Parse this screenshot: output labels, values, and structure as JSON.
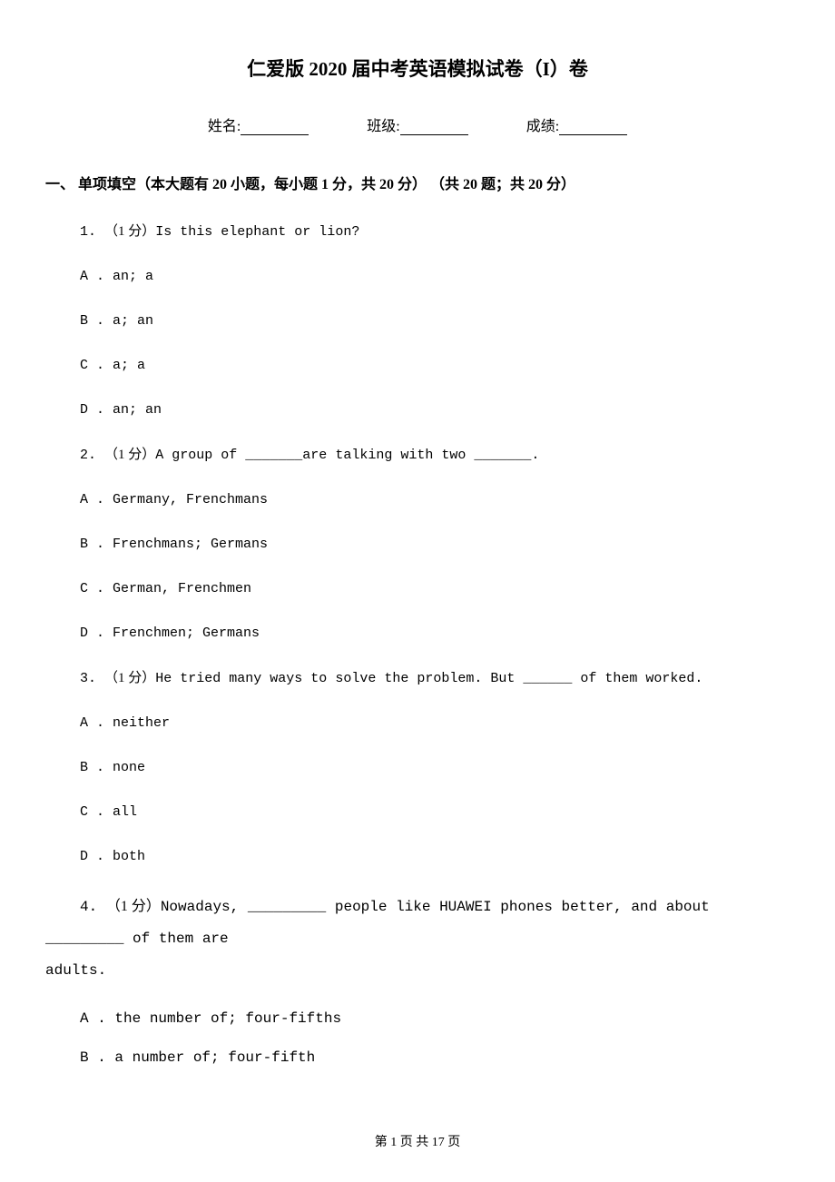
{
  "title": "仁爱版 2020 届中考英语模拟试卷（I）卷",
  "info": {
    "name_label": "姓名:",
    "class_label": "班级:",
    "score_label": "成绩:"
  },
  "section1": {
    "header": "一、 单项填空（本大题有 20 小题，每小题 1 分，共 20 分） （共 20 题；共 20 分）"
  },
  "q1": {
    "num": "1. ",
    "points": "（1 分）",
    "text_a": "Is this      elephant or        lion?",
    "options": {
      "a": "A . an; a",
      "b": "B . a; an",
      "c": "C . a; a",
      "d": "D . an; an"
    }
  },
  "q2": {
    "num": "2. ",
    "points": "（1 分）",
    "text_a": "A group of _______are talking with two _______.",
    "options": {
      "a": "A . Germany, Frenchmans",
      "b": "B . Frenchmans; Germans",
      "c": "C . German, Frenchmen",
      "d": "D . Frenchmen; Germans"
    }
  },
  "q3": {
    "num": "3. ",
    "points": "（1 分）",
    "text_a": "He tried many ways to solve the problem. But ______ of them worked.",
    "options": {
      "a": "A . neither",
      "b": "B . none",
      "c": "C . all",
      "d": "D . both"
    }
  },
  "q4": {
    "num": "4. ",
    "points": "（1 分）",
    "text_a": "Nowadays, _________ people like HUAWEI phones better, and about _________ of them are",
    "text_b": "adults.",
    "options": {
      "a": "A . the number of; four-fifths",
      "b": "B . a number of; four-fifth"
    }
  },
  "footer": "第 1 页 共 17 页"
}
